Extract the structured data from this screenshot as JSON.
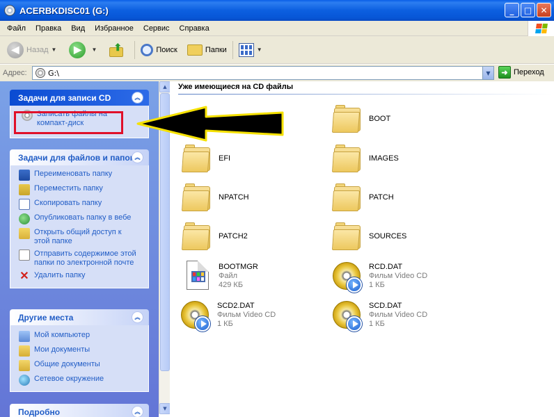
{
  "window": {
    "title": "ACERBKDISC01 (G:)",
    "controls": {
      "minimize": "_",
      "maximize": "□",
      "close": "✕"
    }
  },
  "menu": [
    "Файл",
    "Правка",
    "Вид",
    "Избранное",
    "Сервис",
    "Справка"
  ],
  "toolbar": {
    "back_label": "Назад",
    "search_label": "Поиск",
    "folders_label": "Папки"
  },
  "address": {
    "label": "Адрес:",
    "value": "G:\\",
    "go_label": "Переход"
  },
  "left_pane": {
    "cd_tasks": {
      "title": "Задачи для записи CD",
      "items": [
        {
          "label": "Записать файлы на компакт-диск",
          "icon": "cd-burn-icon"
        }
      ]
    },
    "file_tasks": {
      "title": "Задачи для файлов и папок",
      "items": [
        {
          "label": "Переименовать папку",
          "icon": "rename-icon"
        },
        {
          "label": "Переместить папку",
          "icon": "move-icon"
        },
        {
          "label": "Скопировать папку",
          "icon": "copy-icon"
        },
        {
          "label": "Опубликовать папку в вебе",
          "icon": "web-publish-icon"
        },
        {
          "label": "Открыть общий доступ к этой папке",
          "icon": "share-icon"
        },
        {
          "label": "Отправить содержимое этой папки по электронной почте",
          "icon": "email-icon"
        },
        {
          "label": "Удалить папку",
          "icon": "delete-icon"
        }
      ]
    },
    "other_places": {
      "title": "Другие места",
      "items": [
        {
          "label": "Мой компьютер",
          "icon": "my-computer-icon"
        },
        {
          "label": "Мои документы",
          "icon": "my-documents-icon"
        },
        {
          "label": "Общие документы",
          "icon": "shared-documents-icon"
        },
        {
          "label": "Сетевое окружение",
          "icon": "network-icon"
        }
      ]
    },
    "details": {
      "title": "Подробно"
    }
  },
  "content": {
    "section_title": "Уже имеющиеся на CD файлы",
    "files": [
      {
        "name": "BOOT",
        "type": "folder"
      },
      {
        "name": "EFI",
        "type": "folder"
      },
      {
        "name": "IMAGES",
        "type": "folder"
      },
      {
        "name": "NPATCH",
        "type": "folder"
      },
      {
        "name": "PATCH",
        "type": "folder"
      },
      {
        "name": "PATCH2",
        "type": "folder"
      },
      {
        "name": "SOURCES",
        "type": "folder"
      },
      {
        "name": "BOOTMGR",
        "type": "file",
        "kind": "Файл",
        "size": "429 КБ"
      },
      {
        "name": "RCD.DAT",
        "type": "vcd",
        "kind": "Фильм Video CD",
        "size": "1 КБ"
      },
      {
        "name": "SCD2.DAT",
        "type": "vcd",
        "kind": "Фильм Video CD",
        "size": "1 КБ"
      },
      {
        "name": "SCD.DAT",
        "type": "vcd",
        "kind": "Фильм Video CD",
        "size": "1 КБ"
      }
    ]
  },
  "colors": {
    "titlebar": "#0a5fe8",
    "task_link": "#215dc6",
    "highlight": "#e0102a",
    "arrow_outline": "#f5e100"
  }
}
